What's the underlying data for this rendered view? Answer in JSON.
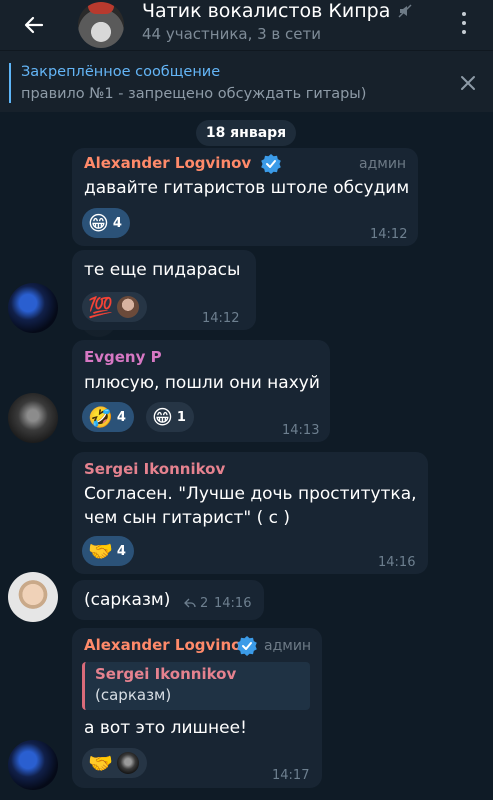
{
  "header": {
    "title": "Чатик вокалистов Кипра",
    "subtitle": "44 участника, 3 в сети"
  },
  "pinned": {
    "title": "Закреплённое сообщение",
    "text": "правило №1 - запрещено обсуждать гитары)"
  },
  "date_separator": "18 января",
  "messages": [
    {
      "sender": "Alexander Logvinov",
      "role": "админ",
      "text": "давайте гитаристов штоле обсудим",
      "time": "14:12",
      "reactions": [
        {
          "emoji": "😁",
          "count": "4"
        }
      ]
    },
    {
      "text": "те еще пидарасы",
      "time": "14:12",
      "reactions": [
        {
          "emoji": "💯"
        }
      ]
    },
    {
      "sender": "Evgeny P",
      "text": "плюсую, пошли они нахуй",
      "time": "14:13",
      "reactions": [
        {
          "emoji": "🤣",
          "count": "4"
        },
        {
          "emoji": "😁",
          "count": "1"
        }
      ]
    },
    {
      "sender": "Sergei Ikonnikov",
      "text_line1": "Согласен. \"Лучше дочь проститутка,",
      "text_line2": "чем сын гитарист\" ( с )",
      "time": "14:16",
      "reactions": [
        {
          "emoji": "🤝",
          "count": "4"
        }
      ]
    },
    {
      "text": "(сарказм)",
      "replies": "2",
      "time": "14:16"
    },
    {
      "sender": "Alexander Logvinov",
      "role": "админ",
      "reply_to_name": "Sergei Ikonnikov",
      "reply_to_text": "(сарказм)",
      "text": "а вот это лишнее!",
      "time": "14:17",
      "reactions": [
        {
          "emoji": "🤝"
        }
      ]
    }
  ],
  "colors": {
    "accent": "#64b5f6",
    "sender_alexander": "#ff8a6a",
    "sender_evgeny": "#d778c4",
    "sender_sergei": "#e5828f",
    "reaction_bg": "#2b5278",
    "bubble_bg": "#182533"
  }
}
